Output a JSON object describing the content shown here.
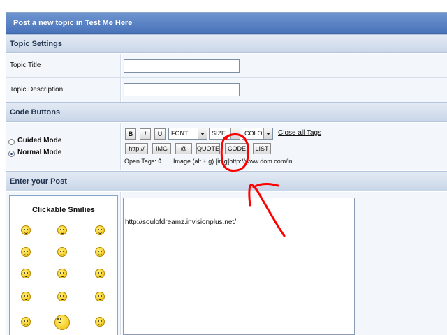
{
  "form": {
    "main_title": "Post a new topic in Test Me Here"
  },
  "topic_settings": {
    "header": "Topic Settings",
    "title_label": "Topic Title",
    "title_value": "",
    "description_label": "Topic Description",
    "description_value": ""
  },
  "code_buttons": {
    "header": "Code Buttons",
    "mode_guided": "Guided Mode",
    "mode_normal": "Normal Mode",
    "selected_mode": "Normal Mode",
    "bold_label": "B",
    "italic_label": "I",
    "underline_label": "U",
    "font_value": "FONT",
    "size_value": "SIZE",
    "color_value": "COLOR",
    "close_all_tags": "Close all Tags",
    "http_label": "http://",
    "img_label": "IMG",
    "email_label": "@",
    "quote_label": "QUOTE",
    "code_label": "CODE",
    "list_label": "LIST",
    "open_tags_label": "Open Tags:",
    "open_tags_count": "0",
    "hint_text": "Image (alt + g) [img]http://www.dom.com/img"
  },
  "post": {
    "header": "Enter your Post",
    "smilies_title": "Clickable Smilies",
    "body": "http://soulofdreamz.invisionplus.net/"
  },
  "annotation": {
    "stroke_color": "#ff0000"
  }
}
